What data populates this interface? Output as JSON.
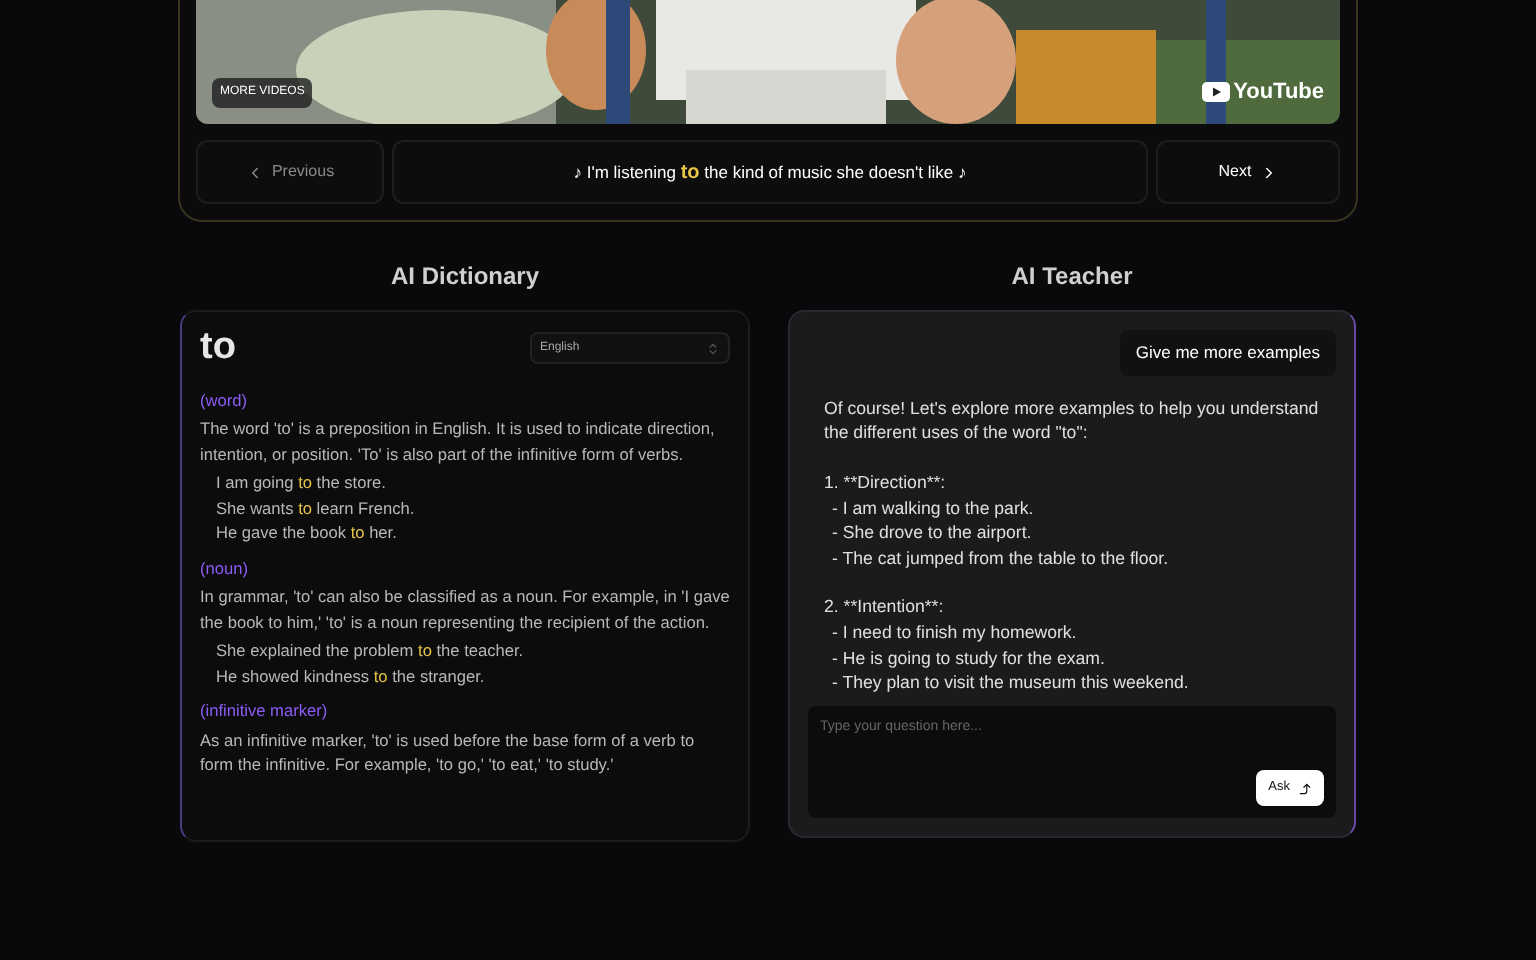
{
  "video": {
    "more_videos": "MORE VIDEOS",
    "brand": "YouTube"
  },
  "nav": {
    "previous": "Previous",
    "next": "Next",
    "subtitle": {
      "before": "♪ I'm listening ",
      "word": "to",
      "after": " the kind of music she doesn't like ♪"
    }
  },
  "dictionary": {
    "title": "AI Dictionary",
    "word": "to",
    "language": "English",
    "senses": [
      {
        "pos": "(word)",
        "definition": "The word 'to' is a preposition in English. It is used to indicate direction, intention, or position. 'To' is also part of the infinitive form of verbs.",
        "examples": [
          {
            "before": "I am going ",
            "word": "to",
            "after": " the store."
          },
          {
            "before": "She wants ",
            "word": "to",
            "after": " learn French."
          },
          {
            "before": "He gave the book ",
            "word": "to",
            "after": " her."
          }
        ]
      },
      {
        "pos": "(noun)",
        "definition": "In grammar, 'to' can also be classified as a noun. For example, in 'I gave the book to him,' 'to' is a noun representing the recipient of the action.",
        "examples": [
          {
            "before": "She explained the problem ",
            "word": "to",
            "after": " the teacher."
          },
          {
            "before": "He showed kindness ",
            "word": "to",
            "after": " the stranger."
          }
        ]
      },
      {
        "pos": "(infinitive marker)",
        "definition": "As an infinitive marker, 'to' is used before the base form of a verb to form the infinitive. For example, 'to go,' 'to eat,' 'to study.'"
      }
    ]
  },
  "teacher": {
    "title": "AI Teacher",
    "user_message": "Give me more examples",
    "reply_intro": "Of course! Let's explore more examples to help you understand the different uses of the word \"to\":",
    "sections": [
      {
        "heading": "1. **Direction**:",
        "items": [
          "- I am walking to the park.",
          "- She drove to the airport.",
          "- The cat jumped from the table to the floor."
        ]
      },
      {
        "heading": "2. **Intention**:",
        "items": [
          "- I need to finish my homework.",
          "- He is going to study for the exam.",
          "- They plan to visit the museum this weekend."
        ]
      }
    ],
    "input": {
      "placeholder": "Type your question here..."
    },
    "ask": "Ask"
  }
}
